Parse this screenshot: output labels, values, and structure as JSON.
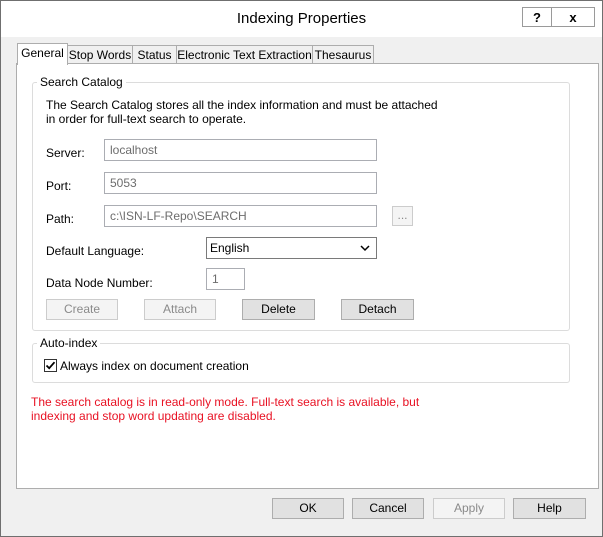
{
  "window": {
    "title": "Indexing Properties",
    "help_label": "?",
    "close_label": "x"
  },
  "tabs": [
    {
      "label": "General",
      "active": true
    },
    {
      "label": "Stop Words",
      "active": false
    },
    {
      "label": "Status",
      "active": false
    },
    {
      "label": "Electronic Text Extraction",
      "active": false
    },
    {
      "label": "Thesaurus",
      "active": false
    }
  ],
  "search_catalog": {
    "legend": "Search Catalog",
    "description_line1": "The Search Catalog stores all the index information and must be attached",
    "description_line2": "in order for full-text search to operate.",
    "server_label": "Server:",
    "server_value": "localhost",
    "port_label": "Port:",
    "port_value": "5053",
    "path_label": "Path:",
    "path_value": "c:\\ISN-LF-Repo\\SEARCH",
    "browse_label": "...",
    "language_label": "Default Language:",
    "language_value": "English",
    "data_node_label": "Data Node Number:",
    "data_node_value": "1",
    "create_label": "Create",
    "attach_label": "Attach",
    "delete_label": "Delete",
    "detach_label": "Detach"
  },
  "auto_index": {
    "legend": "Auto-index",
    "checkbox_label": "Always index on document creation",
    "checked": true
  },
  "warning": {
    "line1": "The search catalog is in read-only mode. Full-text search is available, but",
    "line2": "indexing and stop word updating are disabled.",
    "color": "#e81123"
  },
  "footer": {
    "ok_label": "OK",
    "cancel_label": "Cancel",
    "apply_label": "Apply",
    "help_label": "Help"
  }
}
